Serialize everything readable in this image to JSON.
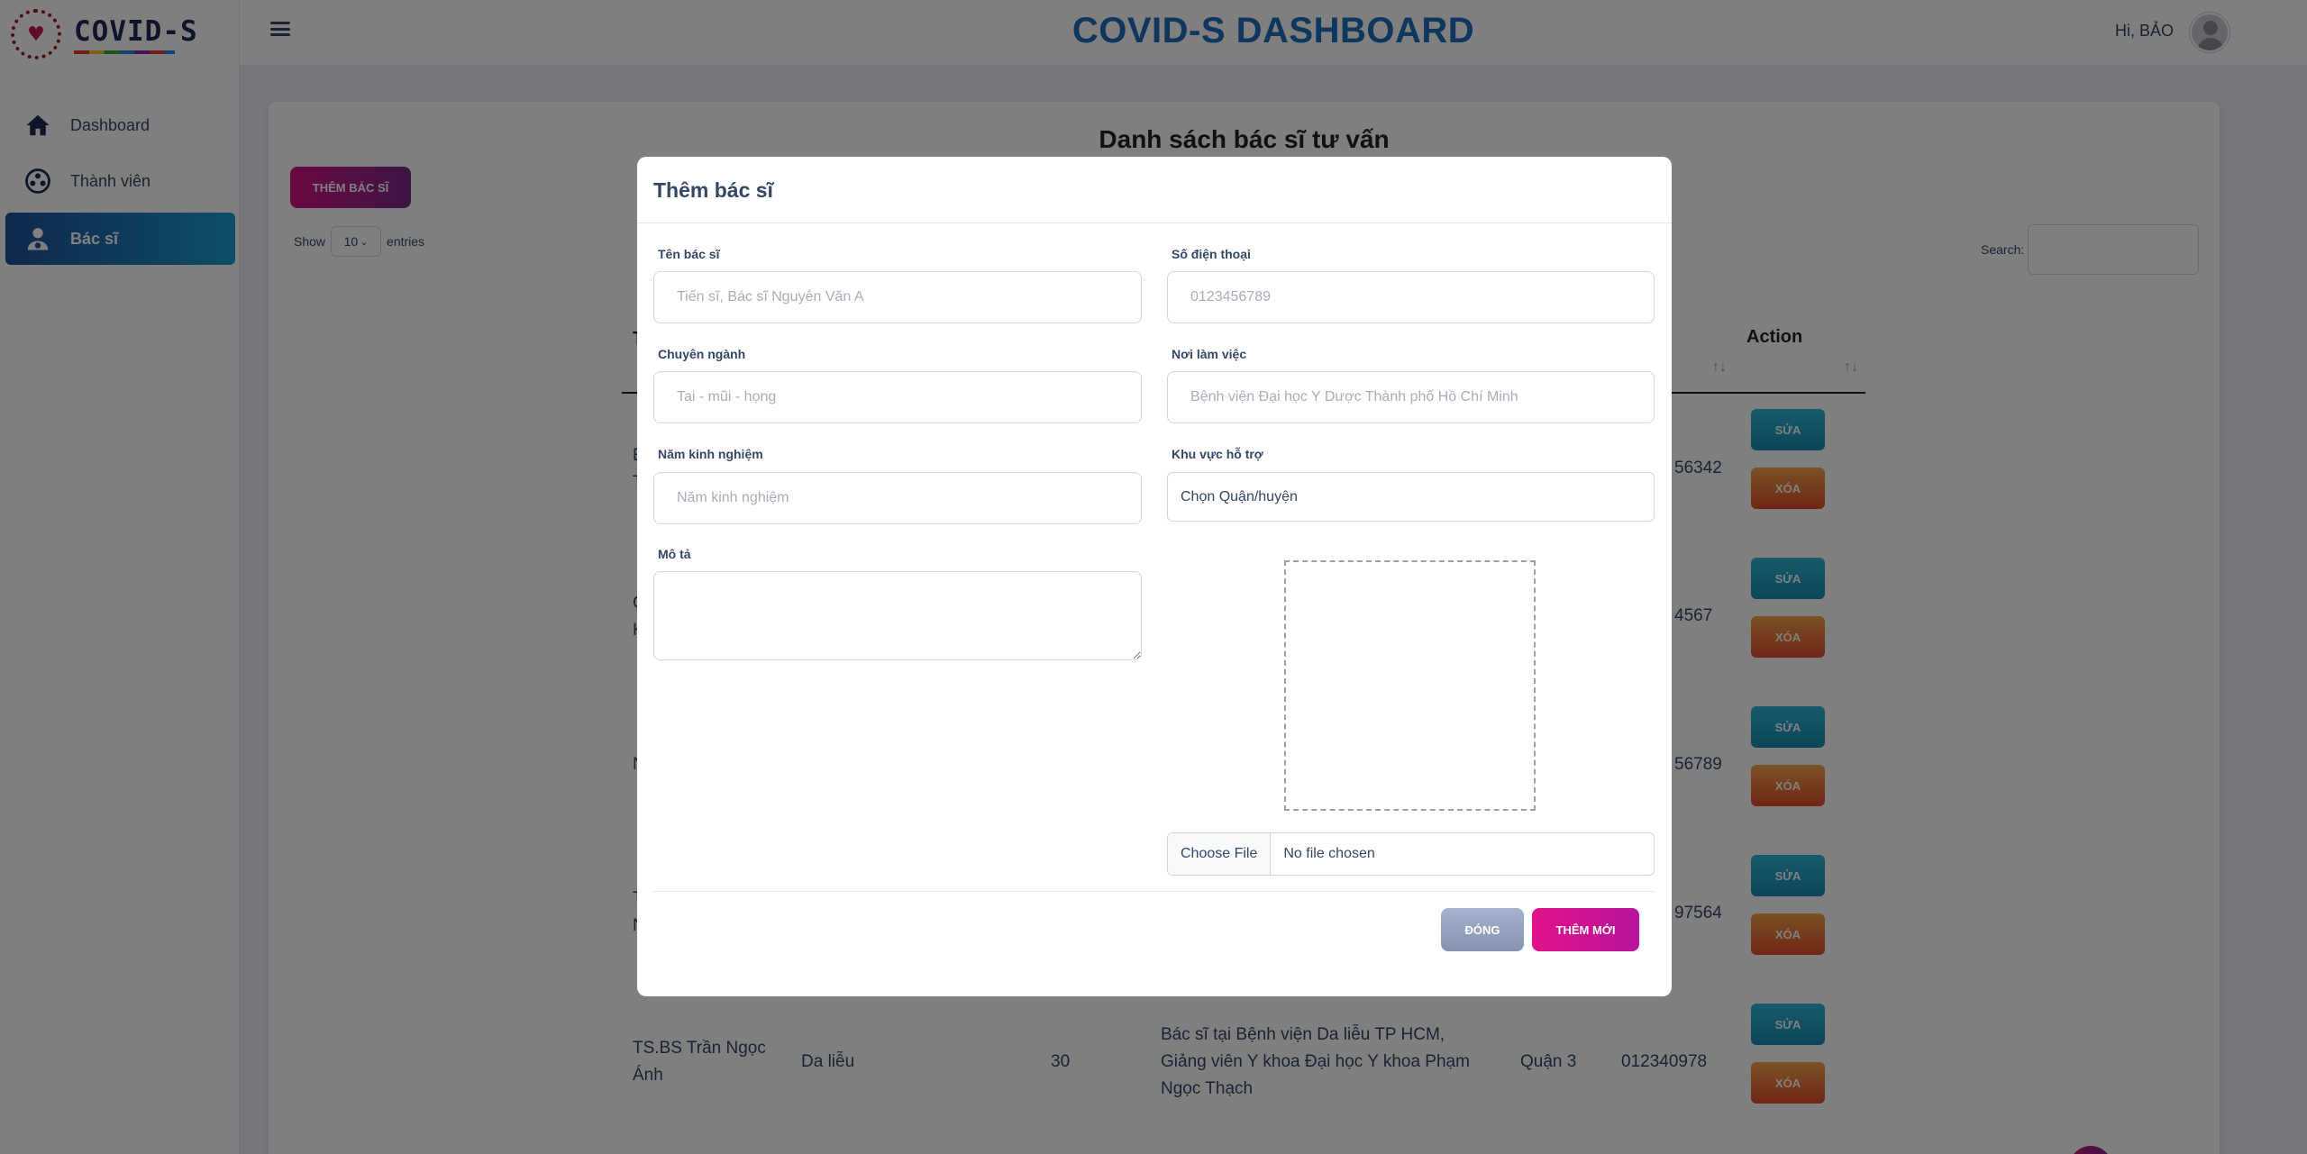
{
  "brand": {
    "name": "COVID-S",
    "logo_icon": "covid-heart-logo"
  },
  "sidebar": {
    "items": [
      {
        "label": "Dashboard",
        "icon": "home-icon"
      },
      {
        "label": "Thành viên",
        "icon": "members-icon"
      },
      {
        "label": "Bác sĩ",
        "icon": "doctor-icon",
        "active": true
      }
    ]
  },
  "header": {
    "title": "COVID-S DASHBOARD",
    "greeting": "Hi, BẢO"
  },
  "page": {
    "title": "Danh sách bác sĩ tư vấn",
    "add_button": "THÊM BÁC SĨ",
    "show_label": "Show",
    "entries_value": "10",
    "entries_label": "entries",
    "search_label": "Search:",
    "columns": {
      "first_partial": "T",
      "action": "Action",
      "sort_glyph": "↑↓"
    },
    "rows": [
      {
        "name_partial": "E\nT",
        "phone_partial": "56342",
        "edit": "SỬA",
        "delete": "XÓA"
      },
      {
        "name_partial": "C\nK",
        "phone_partial": "4567",
        "edit": "SỬA",
        "delete": "XÓA"
      },
      {
        "name_partial": "N",
        "phone_partial": "56789",
        "edit": "SỬA",
        "delete": "XÓA"
      },
      {
        "name_partial": "T\nN",
        "phone_partial": "97564",
        "edit": "SỬA",
        "delete": "XÓA"
      },
      {
        "name": "TS.BS Trần Ngọc Ánh",
        "specialty": "Da liễu",
        "experience": "30",
        "description": "Bác sĩ tại Bệnh viện Da liễu TP HCM, Giảng viên Y khoa Đại học Y khoa Phạm Ngọc Thạch",
        "district": "Quận 3",
        "phone": "012340978",
        "edit": "SỬA",
        "delete": "XÓA"
      }
    ]
  },
  "modal": {
    "title": "Thêm bác sĩ",
    "fields": {
      "name": {
        "label": "Tên bác sĩ",
        "placeholder": "Tiến sĩ, Bác sĩ Nguyễn Văn A"
      },
      "phone": {
        "label": "Số điện thoại",
        "placeholder": "0123456789"
      },
      "specialty": {
        "label": "Chuyên ngành",
        "placeholder": "Tai - mũi - họng"
      },
      "workplace": {
        "label": "Nơi làm việc",
        "placeholder": "Bệnh viện Đại học Y Dược Thành phố Hồ Chí Minh"
      },
      "experience": {
        "label": "Năm kinh nghiệm",
        "placeholder": "Năm kinh nghiệm"
      },
      "area": {
        "label": "Khu vực hỗ trợ",
        "value": "Chọn Quận/huyện"
      },
      "description": {
        "label": "Mô tả"
      }
    },
    "file": {
      "button": "Choose File",
      "status": "No file chosen"
    },
    "close_button": "ĐÓNG",
    "submit_button": "THÊM MỚI"
  }
}
